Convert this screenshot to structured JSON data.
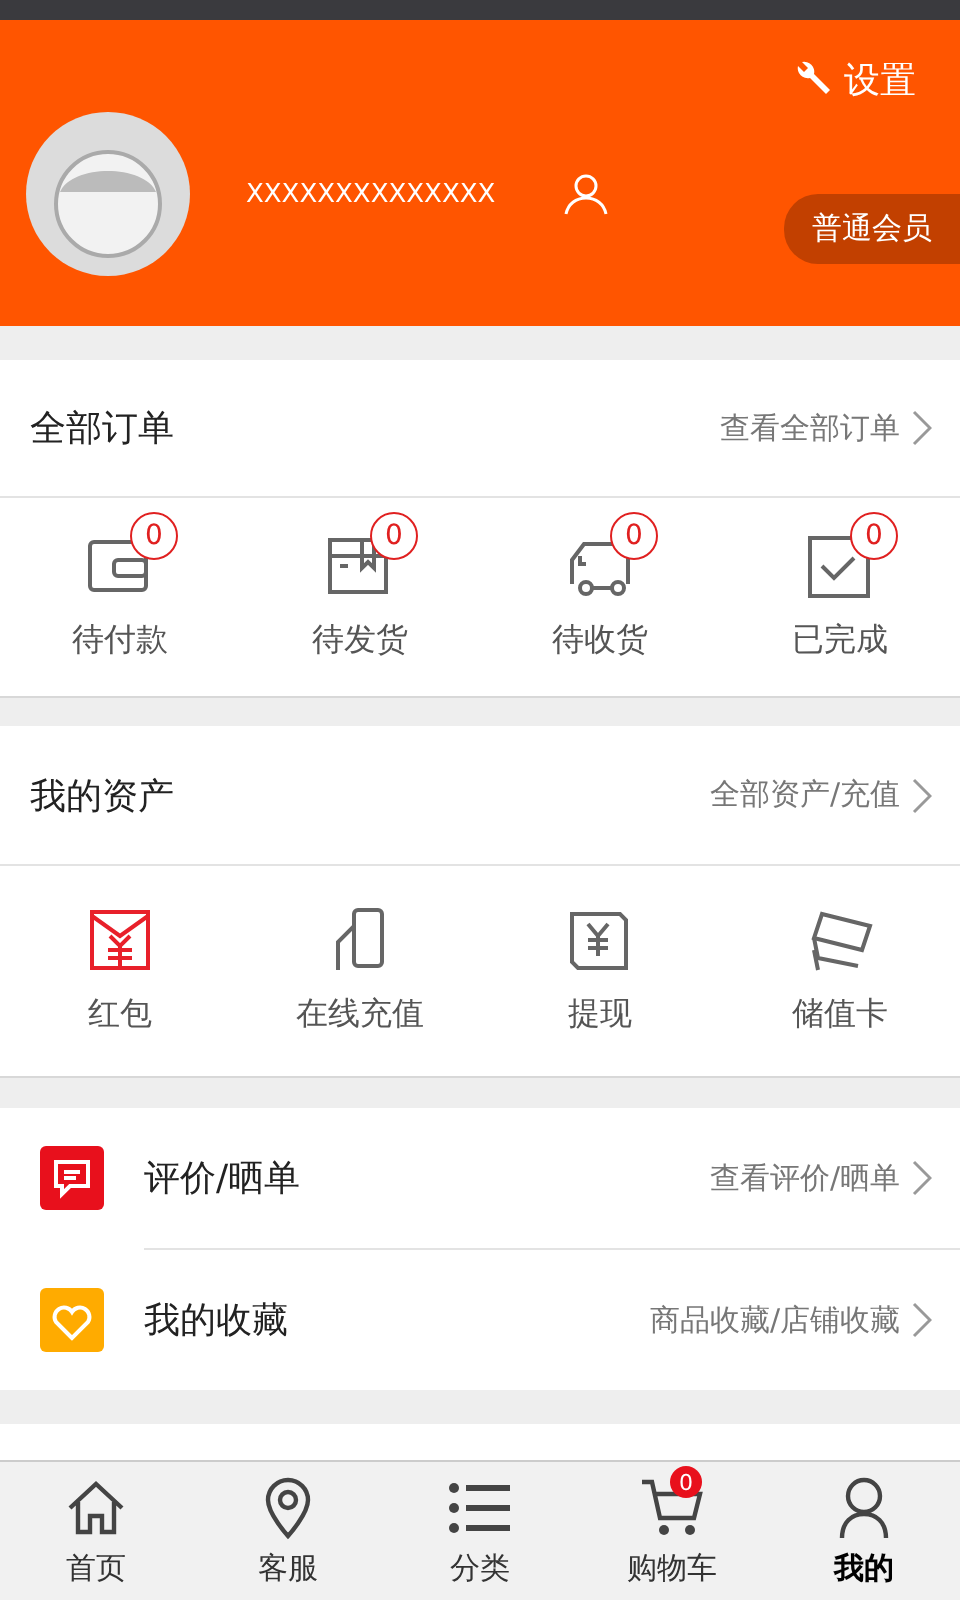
{
  "header": {
    "settings": "设置",
    "username": "XXXXXXXXXXXXXX",
    "member_level": "普通会员"
  },
  "orders": {
    "title": "全部订单",
    "link": "查看全部订单",
    "items": [
      {
        "kind": "wallet",
        "label": "待付款",
        "count": "0"
      },
      {
        "kind": "box",
        "label": "待发货",
        "count": "0"
      },
      {
        "kind": "truck",
        "label": "待收货",
        "count": "0"
      },
      {
        "kind": "check",
        "label": "已完成",
        "count": "0"
      }
    ]
  },
  "assets": {
    "title": "我的资产",
    "link": "全部资产/充值",
    "items": [
      {
        "kind": "envelope",
        "label": "红包"
      },
      {
        "kind": "card-hand",
        "label": "在线充值"
      },
      {
        "kind": "yen-note",
        "label": "提现"
      },
      {
        "kind": "cards",
        "label": "储值卡"
      }
    ]
  },
  "menu": [
    {
      "kind": "comment",
      "title": "评价/晒单",
      "link": "查看评价/晒单"
    },
    {
      "kind": "heart",
      "title": "我的收藏",
      "link": "商品收藏/店铺收藏"
    }
  ],
  "tab_bar": [
    {
      "kind": "home",
      "label": "首页",
      "selected": false
    },
    {
      "kind": "pin",
      "label": "客服",
      "selected": false
    },
    {
      "kind": "list",
      "label": "分类",
      "selected": false
    },
    {
      "kind": "cart",
      "label": "购物车",
      "selected": false,
      "badge": "0"
    },
    {
      "kind": "user",
      "label": "我的",
      "selected": true
    }
  ]
}
